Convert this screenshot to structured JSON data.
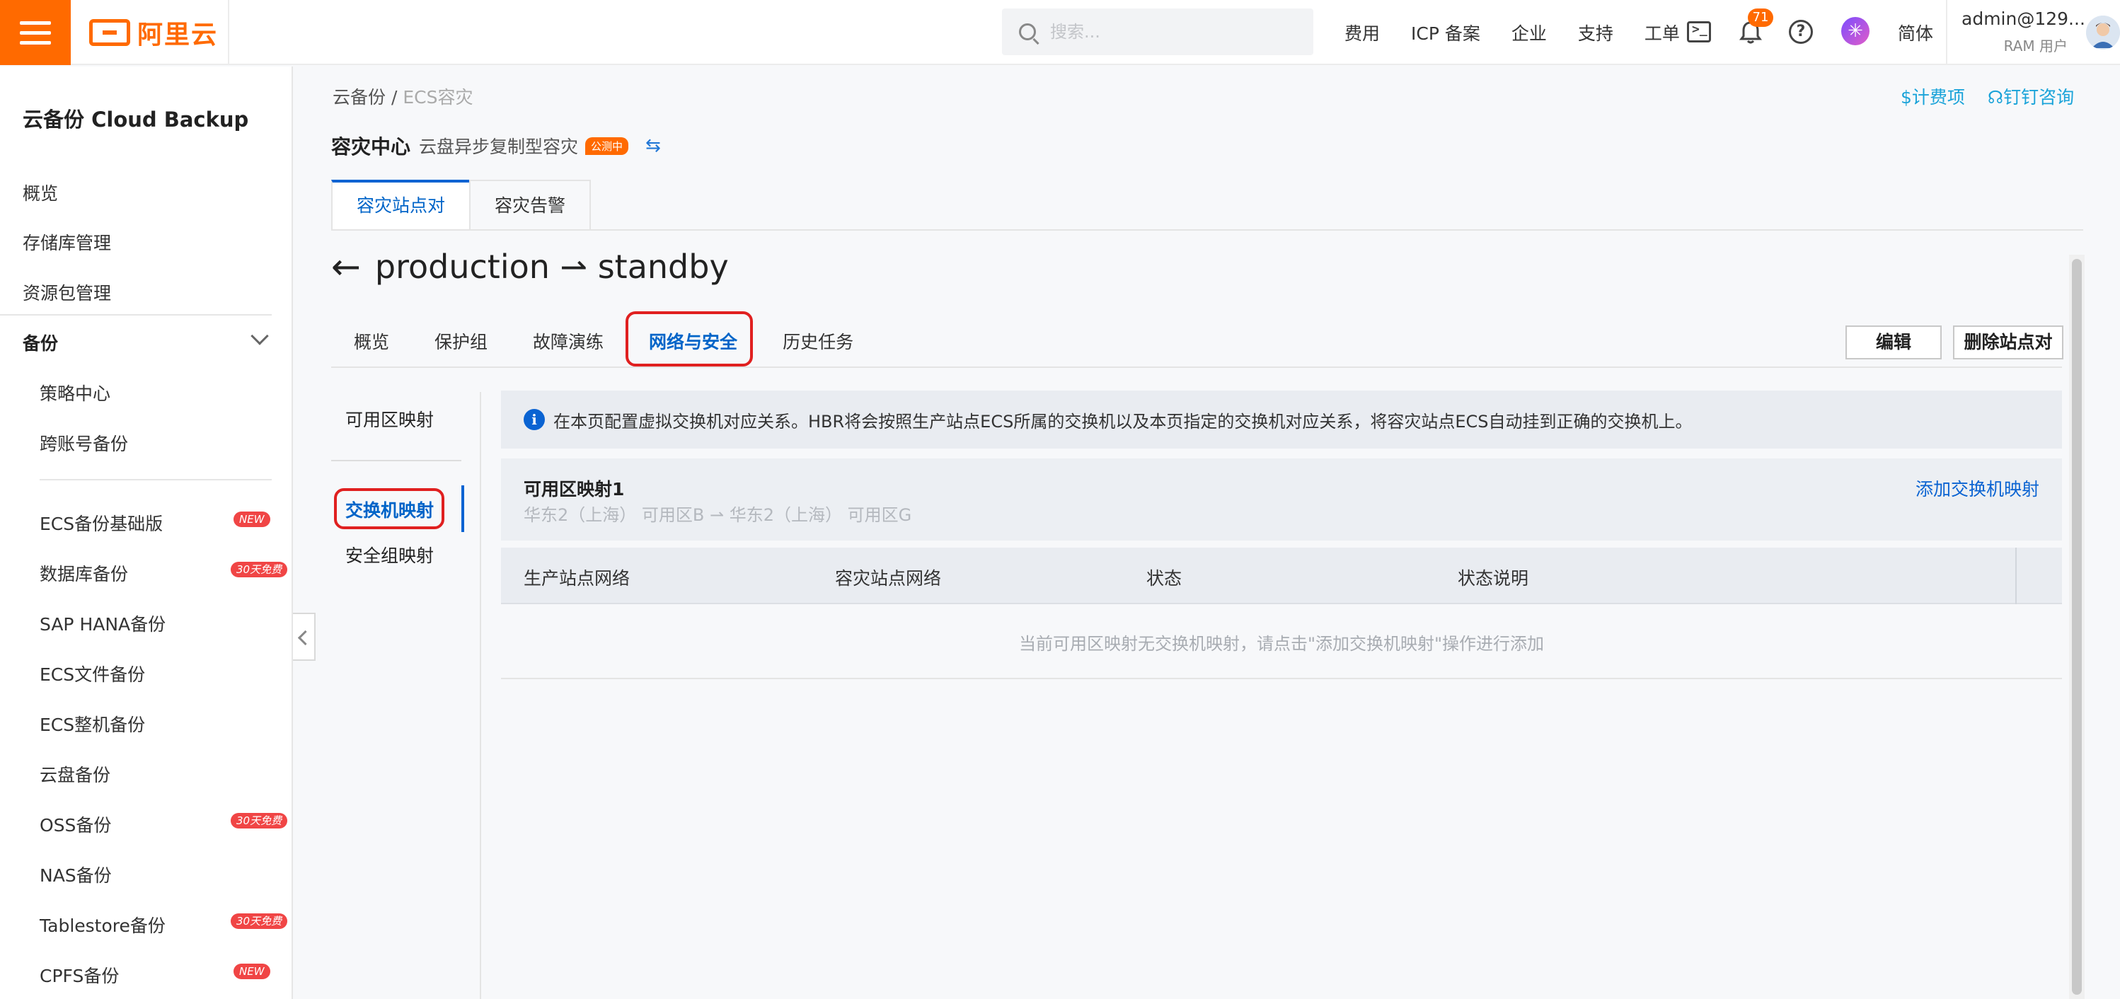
{
  "topbar": {
    "logo_text": "阿里云",
    "search_placeholder": "搜索...",
    "nav": [
      "费用",
      "ICP 备案",
      "企业",
      "支持",
      "工单"
    ],
    "notification_count": "71",
    "language": "简体",
    "user_name": "admin@129...",
    "user_role": "RAM 用户",
    "accent_color": "#ff6a00"
  },
  "sidebar": {
    "title": "云备份 Cloud Backup",
    "top_items": [
      "概览",
      "存储库管理",
      "资源包管理"
    ],
    "group_label": "备份",
    "group_items": [
      "策略中心",
      "跨账号备份"
    ],
    "products": [
      {
        "label": "ECS备份基础版",
        "tag": "NEW"
      },
      {
        "label": "数据库备份",
        "tag": "30天免费"
      },
      {
        "label": "SAP HANA备份",
        "tag": ""
      },
      {
        "label": "ECS文件备份",
        "tag": ""
      },
      {
        "label": "ECS整机备份",
        "tag": ""
      },
      {
        "label": "云盘备份",
        "tag": ""
      },
      {
        "label": "OSS备份",
        "tag": "30天免费"
      },
      {
        "label": "NAS备份",
        "tag": ""
      },
      {
        "label": "Tablestore备份",
        "tag": "30天免费"
      },
      {
        "label": "CPFS备份",
        "tag": "NEW"
      }
    ]
  },
  "breadcrumb": {
    "root": "云备份",
    "sep": " / ",
    "current": "ECS容灾"
  },
  "top_links": {
    "billing": "计费项",
    "dingtalk": "钉钉咨询"
  },
  "header": {
    "title": "容灾中心",
    "subtitle": "云盘异步复制型容灾",
    "badge": "公测中"
  },
  "center_tabs": [
    "容灾站点对",
    "容灾告警"
  ],
  "site_pair": {
    "title": "production ⇀ standby"
  },
  "sub_tabs": [
    "概览",
    "保护组",
    "故障演练",
    "网络与安全",
    "历史任务"
  ],
  "actions": {
    "edit": "编辑",
    "delete": "删除站点对"
  },
  "side_nav": [
    "可用区映射",
    "交换机映射",
    "安全组映射"
  ],
  "info": "在本页配置虚拟交换机对应关系。HBR将会按照生产站点ECS所属的交换机以及本页指定的交换机对应关系，将容灾站点ECS自动挂到正确的交换机上。",
  "zone": {
    "title": "可用区映射1",
    "detail": "华东2（上海） 可用区B  ⇀  华东2（上海） 可用区G",
    "add_link": "添加交换机映射"
  },
  "table": {
    "columns": [
      "生产站点网络",
      "容灾站点网络",
      "状态",
      "状态说明"
    ],
    "empty_text": "当前可用区映射无交换机映射，请点击\"添加交换机映射\"操作进行添加"
  }
}
